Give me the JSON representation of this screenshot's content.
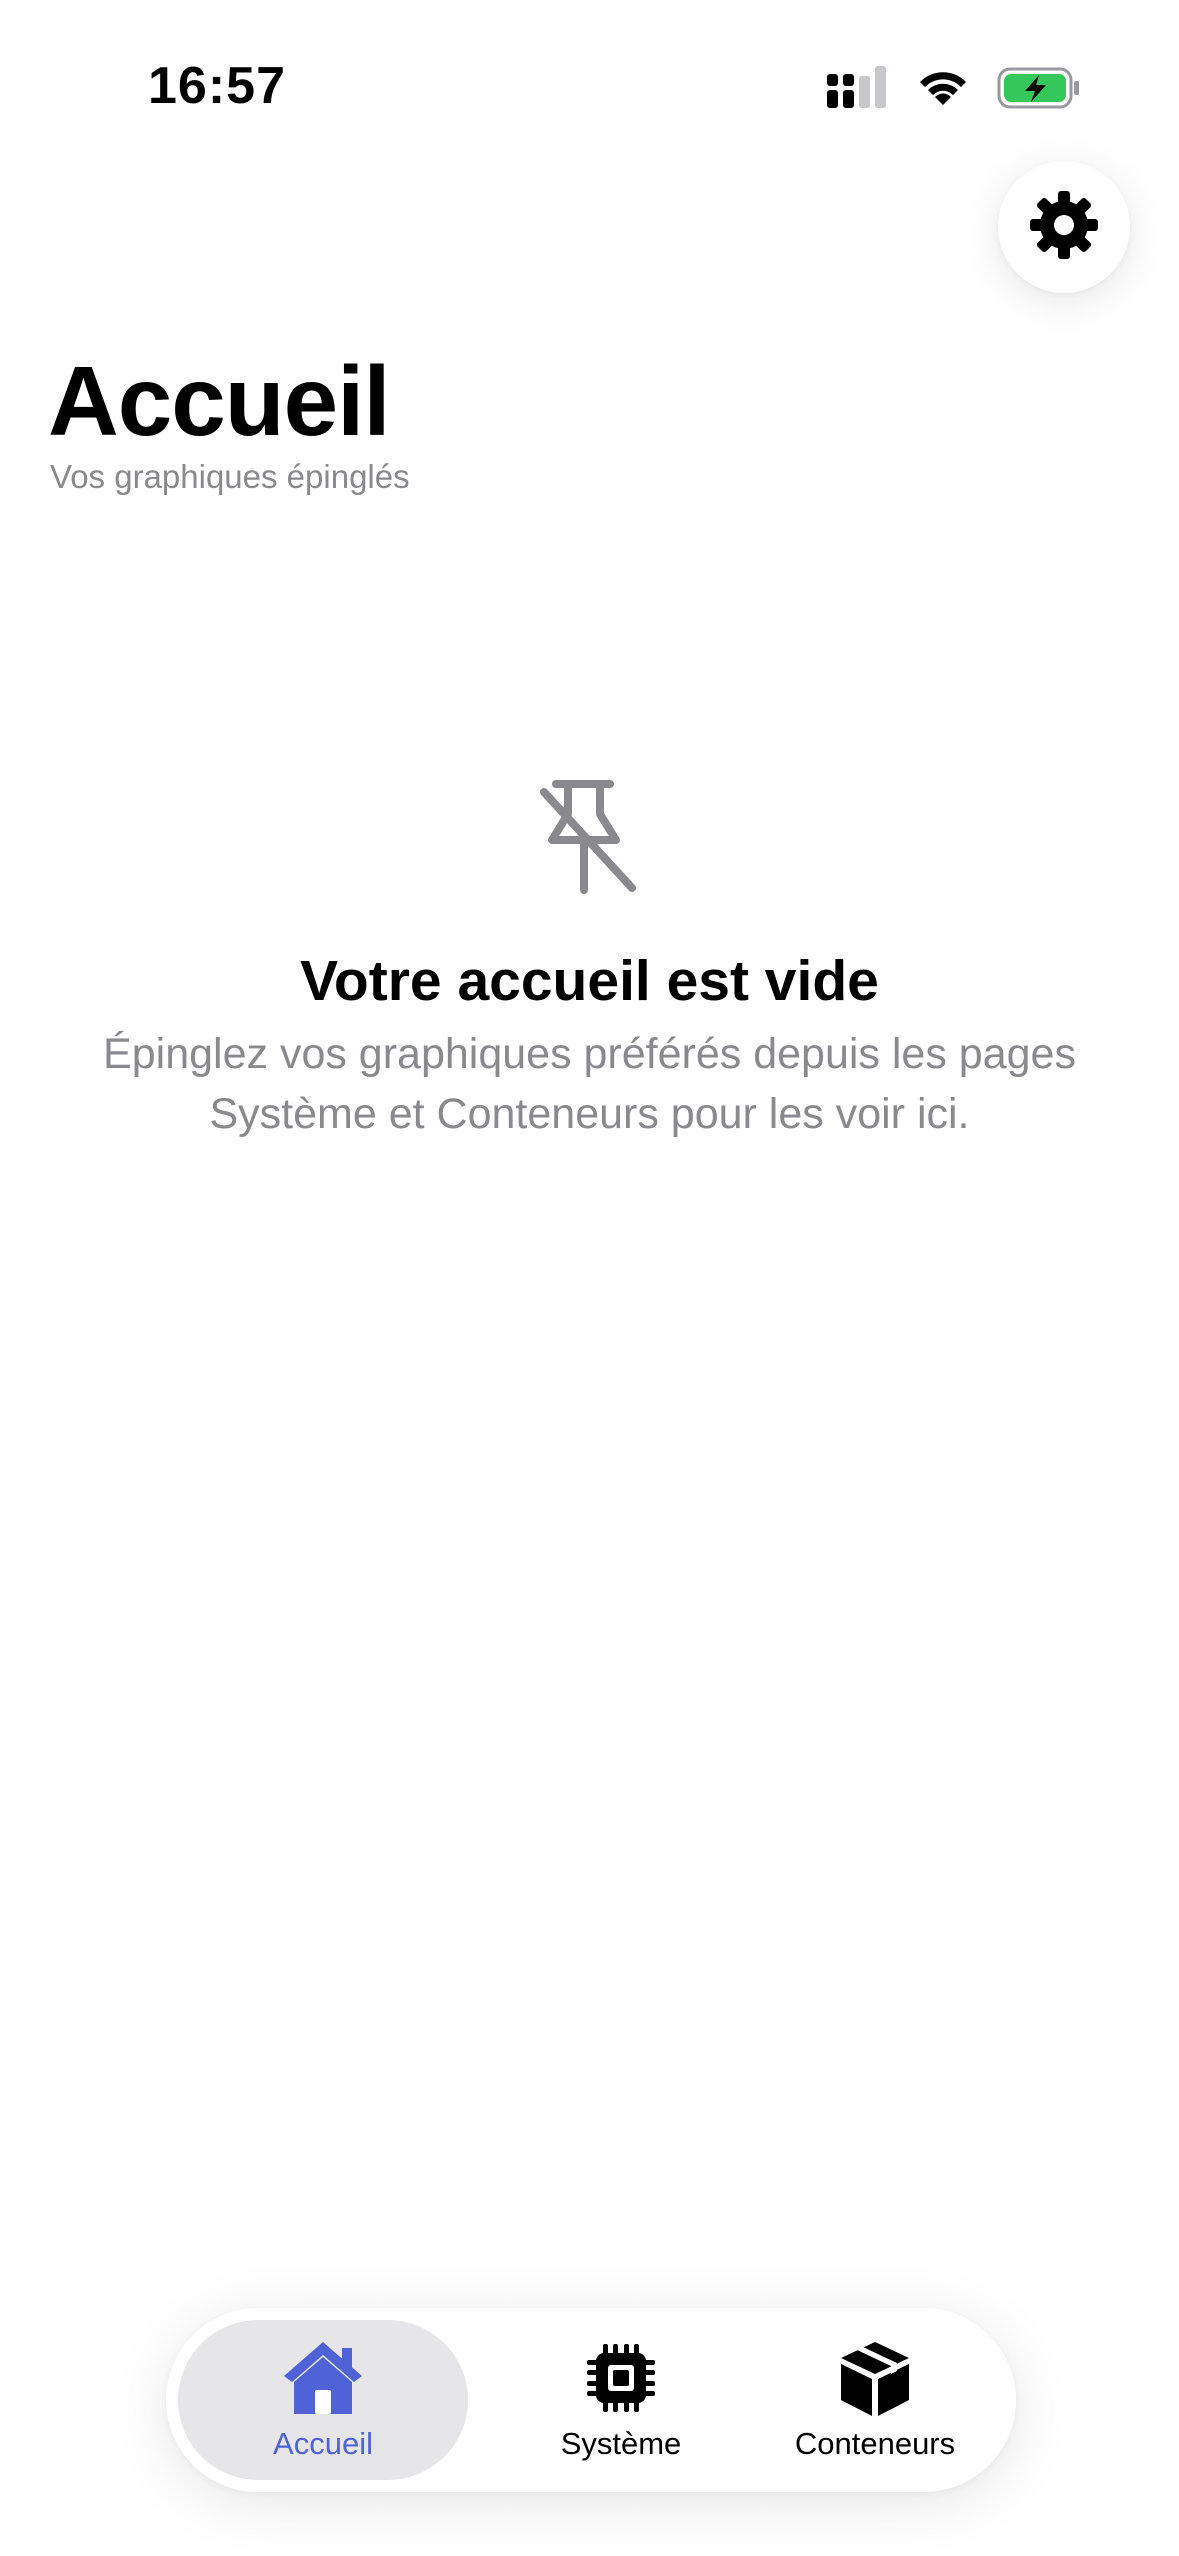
{
  "status_bar": {
    "time": "16:57",
    "icons": [
      "cellular-signal-icon",
      "wifi-icon",
      "battery-charging-icon"
    ],
    "battery_color": "#34c759"
  },
  "settings": {
    "icon": "gear-icon"
  },
  "header": {
    "title": "Accueil",
    "subtitle": "Vos graphiques épinglés"
  },
  "empty_state": {
    "icon": "pin-slash-icon",
    "title": "Votre accueil est vide",
    "description": "Épinglez vos graphiques préférés depuis les pages Système et Conteneurs pour les voir ici."
  },
  "tab_bar": {
    "accent_color": "#4f63d6",
    "active_tab": "Accueil",
    "tabs": [
      {
        "label": "Accueil",
        "icon": "house-icon"
      },
      {
        "label": "Système",
        "icon": "cpu-icon"
      },
      {
        "label": "Conteneurs",
        "icon": "box-icon"
      }
    ]
  }
}
